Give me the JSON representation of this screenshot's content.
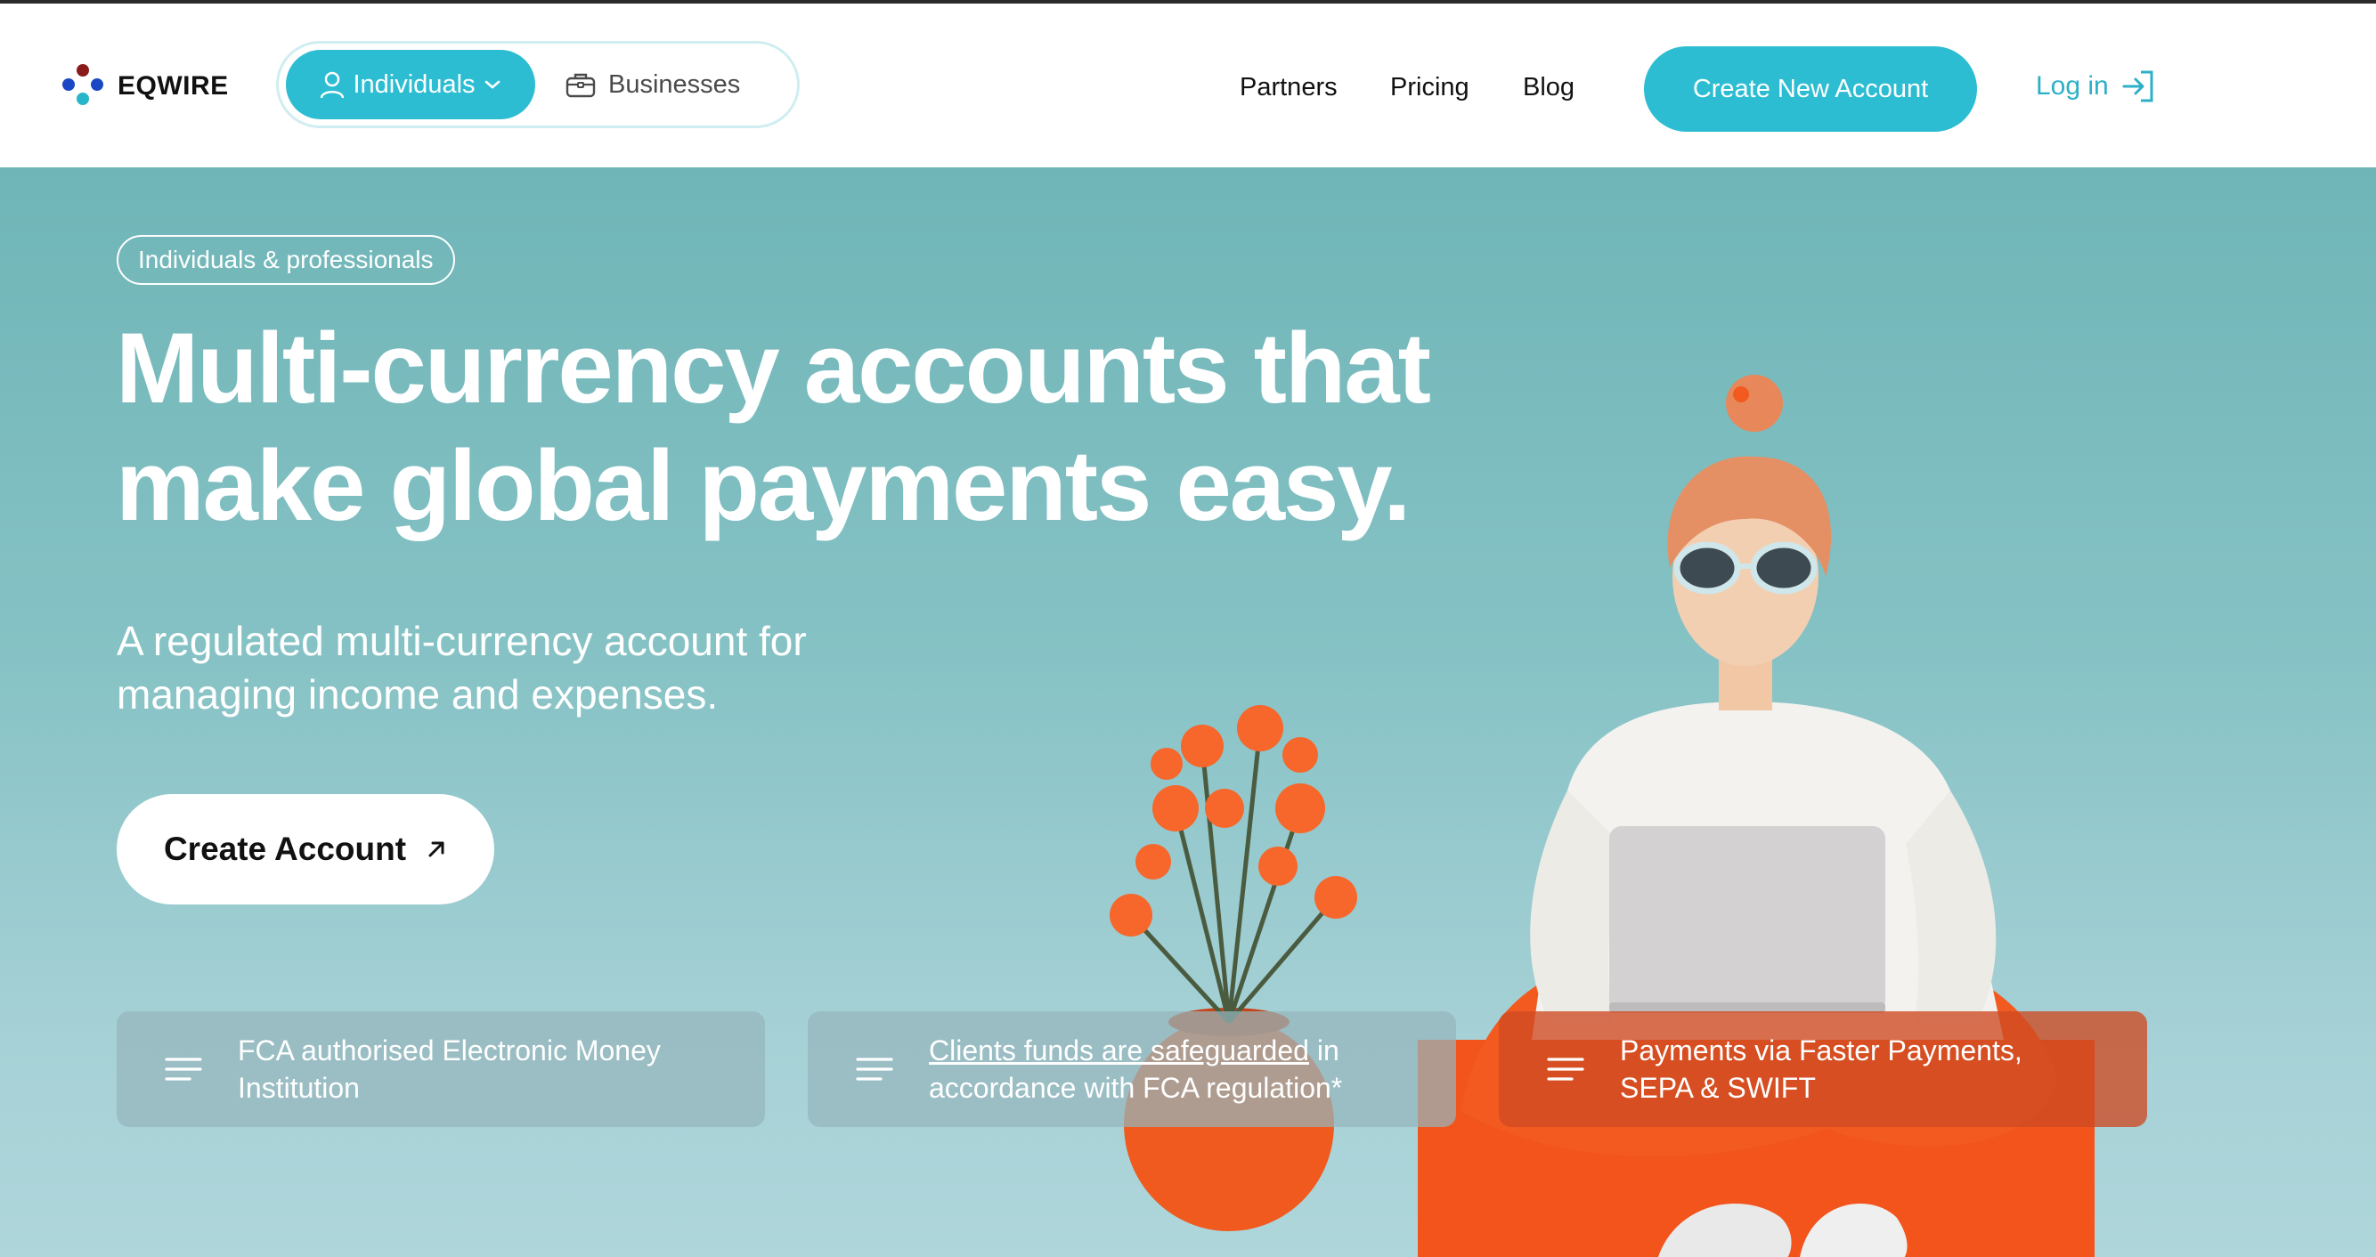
{
  "brand": {
    "name": "EQWIRE"
  },
  "header": {
    "segment": {
      "individuals": "Individuals",
      "businesses": "Businesses"
    },
    "nav": [
      "Partners",
      "Pricing",
      "Blog"
    ],
    "create_new_account": "Create New Account",
    "login": "Log in"
  },
  "hero": {
    "chip": "Individuals & professionals",
    "title_line1": "Multi-currency accounts that",
    "title_line2": "make global payments easy.",
    "subtitle_line1": "A regulated multi-currency account for",
    "subtitle_line2": "managing income and expenses.",
    "cta": "Create Account"
  },
  "features": [
    {
      "text": "FCA authorised Electronic Money Institution"
    },
    {
      "link": "Clients funds are safeguarded",
      "text": " in accordance with FCA regulation*"
    },
    {
      "text": "Payments via Faster Payments, SEPA & SWIFT"
    }
  ],
  "colors": {
    "accent": "#2cbdd2",
    "hero_bg": "#86c2c5",
    "orange": "#f2541b"
  },
  "icons": [
    "logo-icon",
    "user-icon",
    "chevron-down-icon",
    "briefcase-icon",
    "login-icon",
    "arrow-up-right-icon",
    "menu-lines-icon"
  ]
}
